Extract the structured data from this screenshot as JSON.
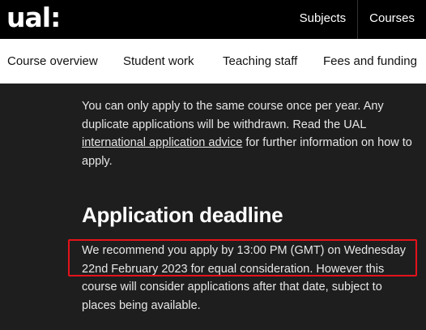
{
  "header": {
    "logo": "ual:",
    "nav": [
      "Subjects",
      "Courses"
    ]
  },
  "tabs": [
    "Course overview",
    "Student work",
    "Teaching staff",
    "Fees and funding"
  ],
  "main": {
    "apply_text_before_link": "You can only apply to the same course once per year. Any duplicate applications will be withdrawn.  Read the UAL ",
    "apply_link": "international application advice",
    "apply_text_after_link": " for further information on how to apply.",
    "deadline_heading": "Application deadline",
    "deadline_text": "We recommend you apply by 13:00 PM (GMT) on Wednesday 22nd February 2023 for equal consideration. However this course will consider applications after that date, subject to places being available."
  },
  "colors": {
    "highlight_border": "#e5121b",
    "background": "#1e1e1e"
  }
}
